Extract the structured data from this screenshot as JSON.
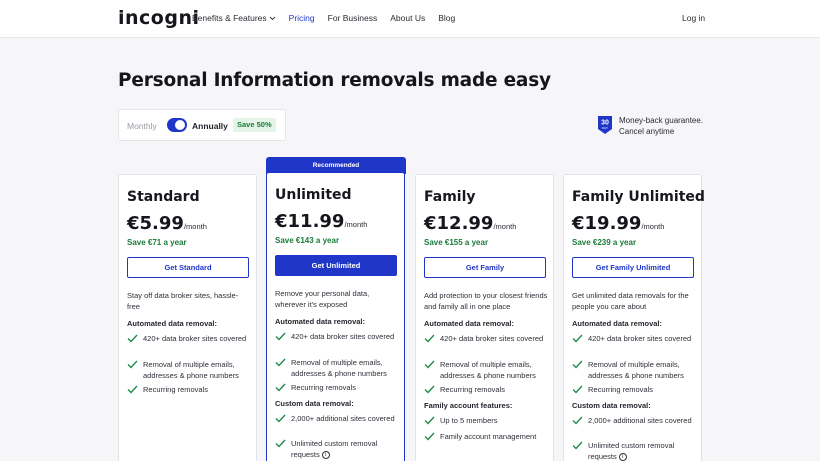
{
  "nav": {
    "logo": "incogni",
    "links": [
      "Benefits & Features",
      "Pricing",
      "For Business",
      "About Us",
      "Blog"
    ],
    "login": "Log in"
  },
  "headline": "Personal Information removals made easy",
  "toggle": {
    "monthly": "Monthly",
    "annually": "Annually",
    "save": "Save 50%"
  },
  "guarantee": {
    "badge_number": "30",
    "badge_unit": "DAY",
    "line1": "Money-back guarantee.",
    "line2": "Cancel anytime"
  },
  "recommended": "Recommended",
  "plans": [
    {
      "title": "Standard",
      "price": "€5.99",
      "per": "/month",
      "save": "Save €71 a year",
      "button": "Get Standard",
      "desc": "Stay off data broker sites, hassle-free",
      "sec1": "Automated data removal:",
      "f1": [
        "420+ data broker sites covered",
        "Removal of multiple emails, addresses & phone numbers",
        "Recurring removals"
      ]
    },
    {
      "title": "Unlimited",
      "price": "€11.99",
      "per": "/month",
      "save": "Save €143 a year",
      "button": "Get Unlimited",
      "desc": "Remove your personal data, wherever it's exposed",
      "sec1": "Automated data removal:",
      "f1": [
        "420+ data broker sites covered",
        "Removal of multiple emails, addresses & phone numbers",
        "Recurring removals"
      ],
      "sec2": "Custom data removal:",
      "f2": [
        "2,000+ additional sites covered",
        "Unlimited custom removal requests"
      ]
    },
    {
      "title": "Family",
      "price": "€12.99",
      "per": "/month",
      "save": "Save €155 a year",
      "button": "Get Family",
      "desc": "Add protection to your closest friends and family all in one place",
      "sec1": "Automated data removal:",
      "f1": [
        "420+ data broker sites covered",
        "Removal of multiple emails, addresses & phone numbers",
        "Recurring removals"
      ],
      "sec2": "Family account features:",
      "f2": [
        "Up to 5 members",
        "Family account management"
      ]
    },
    {
      "title": "Family Unlimited",
      "price": "€19.99",
      "per": "/month",
      "save": "Save €239 a year",
      "button": "Get Family Unlimited",
      "desc": "Get unlimited data removals for the people you care about",
      "sec1": "Automated data removal:",
      "f1": [
        "420+ data broker sites covered",
        "Removal of multiple emails, addresses & phone numbers",
        "Recurring removals"
      ],
      "sec2": "Custom data removal:",
      "f2": [
        "2,000+ additional sites covered",
        "Unlimited custom removal requests"
      ]
    }
  ],
  "colors": {
    "accent": "#1f36c8",
    "save_green": "#1a7a3a",
    "check_green": "#1a8a48"
  },
  "icons": {
    "check": "check-icon",
    "info": "info-icon",
    "chevron": "chevron-down-icon",
    "badge": "shield-30-icon"
  }
}
